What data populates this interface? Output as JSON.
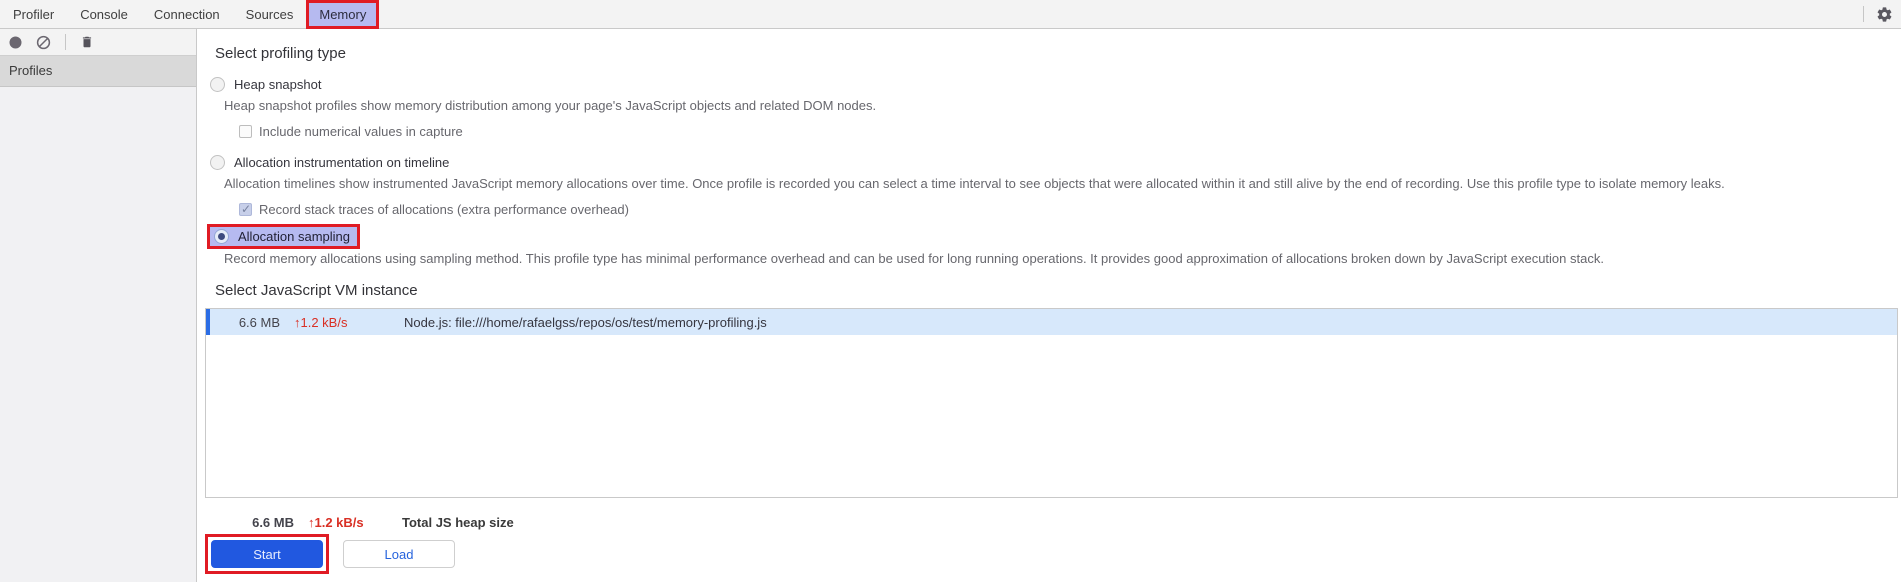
{
  "tabs": {
    "items": [
      {
        "label": "Profiler"
      },
      {
        "label": "Console"
      },
      {
        "label": "Connection"
      },
      {
        "label": "Sources"
      },
      {
        "label": "Memory"
      }
    ],
    "active": "Memory"
  },
  "header_icons": [
    "gear-icon"
  ],
  "toolbar_icons": [
    "record-icon",
    "clear-icon",
    "trash-icon"
  ],
  "sidebar": {
    "header": "Profiles"
  },
  "profiling": {
    "heading": "Select profiling type",
    "options": [
      {
        "label": "Heap snapshot",
        "selected": false,
        "description": "Heap snapshot profiles show memory distribution among your page's JavaScript objects and related DOM nodes.",
        "checkbox": {
          "label": "Include numerical values in capture",
          "checked": false
        }
      },
      {
        "label": "Allocation instrumentation on timeline",
        "selected": false,
        "description": "Allocation timelines show instrumented JavaScript memory allocations over time. Once profile is recorded you can select a time interval to see objects that were allocated within it and still alive by the end of recording. Use this profile type to isolate memory leaks.",
        "checkbox": {
          "label": "Record stack traces of allocations (extra performance overhead)",
          "checked": true
        }
      },
      {
        "label": "Allocation sampling",
        "selected": true,
        "highlighted": true,
        "description": "Record memory allocations using sampling method. This profile type has minimal performance overhead and can be used for long running operations. It provides good approximation of allocations broken down by JavaScript execution stack."
      }
    ]
  },
  "vm": {
    "heading": "Select JavaScript VM instance",
    "rows": [
      {
        "size": "6.6 MB",
        "rate": "↑1.2 kB/s",
        "name": "Node.js: file:///home/rafaelgss/repos/os/test/memory-profiling.js",
        "selected": true
      }
    ],
    "total": {
      "size": "6.6 MB",
      "rate": "↑1.2 kB/s",
      "label": "Total JS heap size"
    }
  },
  "actions": {
    "start": "Start",
    "load": "Load"
  },
  "colors": {
    "annotation_red": "#e01b24",
    "active_tab_bg": "#b6baf0",
    "selected_row_bg": "#d7e8fb",
    "selection_bar_blue": "#2b6de5",
    "rate_red": "#d93025",
    "primary_button_blue": "#2158e0"
  }
}
